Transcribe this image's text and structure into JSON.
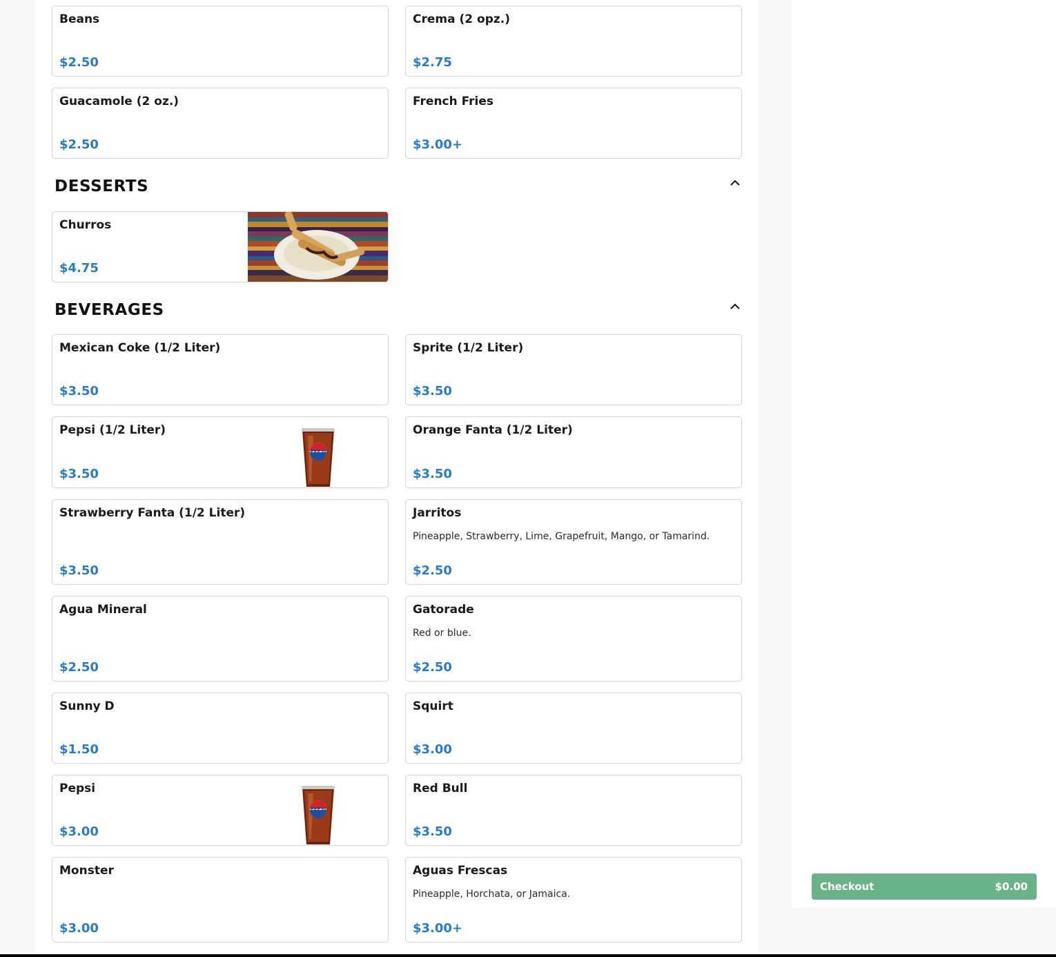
{
  "sides": {
    "items": [
      {
        "name": "Beans",
        "price": "$2.50"
      },
      {
        "name": "Crema (2 opz.)",
        "price": "$2.75"
      },
      {
        "name": "Guacamole (2 oz.)",
        "price": "$2.50"
      },
      {
        "name": "French Fries",
        "price": "$3.00+"
      }
    ]
  },
  "desserts": {
    "title": "DESSERTS",
    "items": [
      {
        "name": "Churros",
        "price": "$4.75"
      }
    ]
  },
  "beverages": {
    "title": "BEVERAGES",
    "items": [
      {
        "name": "Mexican Coke (1/2 Liter)",
        "price": "$3.50"
      },
      {
        "name": "Sprite (1/2 Liter)",
        "price": "$3.50"
      },
      {
        "name": "Pepsi (1/2 Liter)",
        "price": "$3.50"
      },
      {
        "name": "Orange Fanta (1/2 Liter)",
        "price": "$3.50"
      },
      {
        "name": "Strawberry Fanta (1/2 Liter)",
        "price": "$3.50"
      },
      {
        "name": "Jarritos",
        "description": "Pineapple, Strawberry, Lime, Grapefruit, Mango, or Tamarind.",
        "price": "$2.50"
      },
      {
        "name": "Agua Mineral",
        "price": "$2.50"
      },
      {
        "name": "Gatorade",
        "description": "Red or blue.",
        "price": "$2.50"
      },
      {
        "name": "Sunny D",
        "price": "$1.50"
      },
      {
        "name": "Squirt",
        "price": "$3.00"
      },
      {
        "name": "Pepsi",
        "price": "$3.00"
      },
      {
        "name": "Red Bull",
        "price": "$3.50"
      },
      {
        "name": "Monster",
        "price": "$3.00"
      },
      {
        "name": "Aguas Frescas",
        "description": "Pineapple, Horchata, or Jamaica.",
        "price": "$3.00+"
      }
    ]
  },
  "cart": {
    "checkout_label": "Checkout",
    "total": "$0.00"
  },
  "icons": {
    "collapse": "chevron-up-icon",
    "product_photo": "pepsi-cup-photo",
    "dessert_photo": "churros-photo"
  },
  "pepsi_logo_text": "PEPSI",
  "colors": {
    "price": "#2a7bc1",
    "checkout": "#6ab287",
    "card_border": "#d4d4d4"
  }
}
